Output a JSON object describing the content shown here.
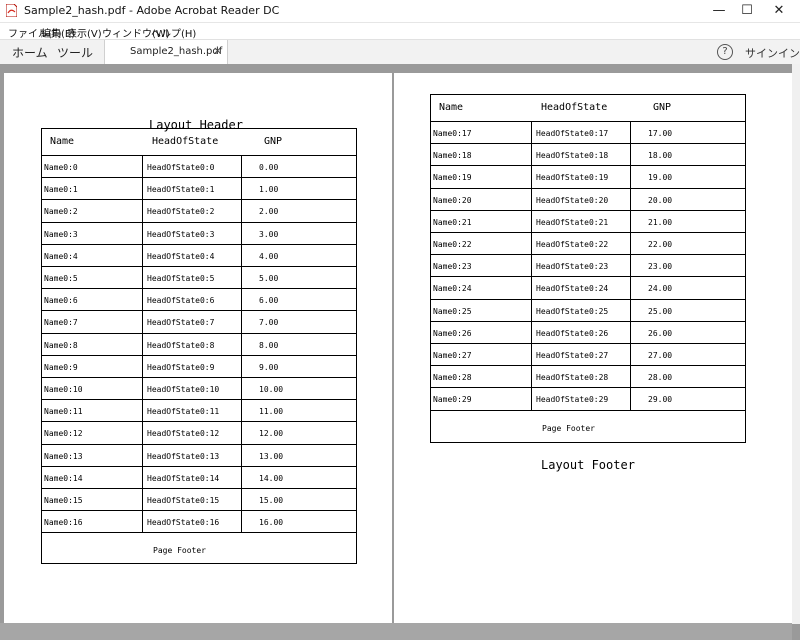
{
  "window": {
    "title": "Sample2_hash.pdf - Adobe Acrobat Reader DC",
    "minimize": "—",
    "maximize": "☐",
    "close": "✕"
  },
  "menu": [
    "ファイル(F)",
    "編集(E)",
    "表示(V)",
    "ウィンドウ(W)",
    "ヘルプ(H)"
  ],
  "toolbar": {
    "home": "ホーム",
    "tools": "ツール",
    "tab_label": "Sample2_hash.pdf",
    "tab_close": "×",
    "help": "?",
    "signin": "サインイン"
  },
  "report": {
    "layout_header": "Layout Header",
    "layout_footer": "Layout Footer",
    "page_footer": "Page Footer",
    "columns": [
      "Name",
      "HeadOfState",
      "GNP"
    ],
    "page1_rows": [
      [
        "Name0:0",
        "HeadOfState0:0",
        "0.00"
      ],
      [
        "Name0:1",
        "HeadOfState0:1",
        "1.00"
      ],
      [
        "Name0:2",
        "HeadOfState0:2",
        "2.00"
      ],
      [
        "Name0:3",
        "HeadOfState0:3",
        "3.00"
      ],
      [
        "Name0:4",
        "HeadOfState0:4",
        "4.00"
      ],
      [
        "Name0:5",
        "HeadOfState0:5",
        "5.00"
      ],
      [
        "Name0:6",
        "HeadOfState0:6",
        "6.00"
      ],
      [
        "Name0:7",
        "HeadOfState0:7",
        "7.00"
      ],
      [
        "Name0:8",
        "HeadOfState0:8",
        "8.00"
      ],
      [
        "Name0:9",
        "HeadOfState0:9",
        "9.00"
      ],
      [
        "Name0:10",
        "HeadOfState0:10",
        "10.00"
      ],
      [
        "Name0:11",
        "HeadOfState0:11",
        "11.00"
      ],
      [
        "Name0:12",
        "HeadOfState0:12",
        "12.00"
      ],
      [
        "Name0:13",
        "HeadOfState0:13",
        "13.00"
      ],
      [
        "Name0:14",
        "HeadOfState0:14",
        "14.00"
      ],
      [
        "Name0:15",
        "HeadOfState0:15",
        "15.00"
      ],
      [
        "Name0:16",
        "HeadOfState0:16",
        "16.00"
      ]
    ],
    "page2_rows": [
      [
        "Name0:17",
        "HeadOfState0:17",
        "17.00"
      ],
      [
        "Name0:18",
        "HeadOfState0:18",
        "18.00"
      ],
      [
        "Name0:19",
        "HeadOfState0:19",
        "19.00"
      ],
      [
        "Name0:20",
        "HeadOfState0:20",
        "20.00"
      ],
      [
        "Name0:21",
        "HeadOfState0:21",
        "21.00"
      ],
      [
        "Name0:22",
        "HeadOfState0:22",
        "22.00"
      ],
      [
        "Name0:23",
        "HeadOfState0:23",
        "23.00"
      ],
      [
        "Name0:24",
        "HeadOfState0:24",
        "24.00"
      ],
      [
        "Name0:25",
        "HeadOfState0:25",
        "25.00"
      ],
      [
        "Name0:26",
        "HeadOfState0:26",
        "26.00"
      ],
      [
        "Name0:27",
        "HeadOfState0:27",
        "27.00"
      ],
      [
        "Name0:28",
        "HeadOfState0:28",
        "28.00"
      ],
      [
        "Name0:29",
        "HeadOfState0:29",
        "29.00"
      ]
    ]
  }
}
